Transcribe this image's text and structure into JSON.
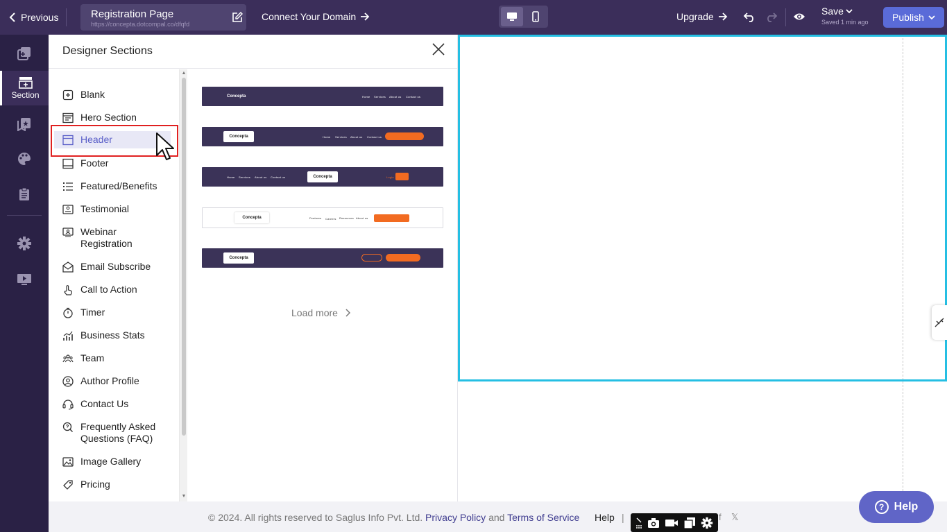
{
  "topbar": {
    "previous_label": "Previous",
    "page_title": "Registration Page",
    "page_url": "https://concepta.dotcompal.co/dfqfd",
    "connect_domain_label": "Connect Your Domain",
    "upgrade_label": "Upgrade",
    "save_label": "Save",
    "saved_status": "Saved 1 min ago",
    "publish_label": "Publish"
  },
  "rail": {
    "items": [
      {
        "icon": "pages-icon",
        "label": ""
      },
      {
        "icon": "section-icon",
        "label": "Section"
      },
      {
        "icon": "bookmark-star-icon",
        "label": ""
      },
      {
        "icon": "palette-icon",
        "label": ""
      },
      {
        "icon": "clipboard-icon",
        "label": ""
      },
      {
        "icon": "gear-icon",
        "label": ""
      },
      {
        "icon": "monitor-play-icon",
        "label": ""
      }
    ]
  },
  "panel": {
    "title": "Designer Sections",
    "categories": [
      {
        "label": "Blank"
      },
      {
        "label": "Hero Section"
      },
      {
        "label": "Header"
      },
      {
        "label": "Footer"
      },
      {
        "label": "Featured/Benefits"
      },
      {
        "label": "Testimonial"
      },
      {
        "label": "Webinar Registration"
      },
      {
        "label": "Email Subscribe"
      },
      {
        "label": "Call to Action"
      },
      {
        "label": "Timer"
      },
      {
        "label": "Business Stats"
      },
      {
        "label": "Team"
      },
      {
        "label": "Author Profile"
      },
      {
        "label": "Contact Us"
      },
      {
        "label": "Frequently Asked Questions (FAQ)"
      },
      {
        "label": "Image Gallery"
      },
      {
        "label": "Pricing"
      }
    ],
    "selected_category": "Header",
    "templates": {
      "brand": "Concepta",
      "nav": [
        "Home",
        "Services",
        "About us",
        "Contact us"
      ],
      "nav_alt": [
        "Features",
        "Careers",
        "Resources",
        "About us"
      ],
      "login": "Login",
      "signup": "Signup"
    },
    "load_more_label": "Load more"
  },
  "footer": {
    "copyright": "© 2024. All rights reserved to Saglus Info Pvt. Ltd.",
    "privacy_label": "Privacy Policy",
    "and_label": "and",
    "terms_label": "Terms of Service",
    "help_label": "Help",
    "separator": "|"
  },
  "help_button_label": "Help",
  "colors": {
    "topbar": "#3b2e5a",
    "rail": "#2a2145",
    "accent": "#5a6bd8",
    "canvas_selection": "#25bfe3",
    "template_dark": "#3b3358",
    "cta_orange": "#f26b21",
    "highlight_red": "#e02020"
  }
}
